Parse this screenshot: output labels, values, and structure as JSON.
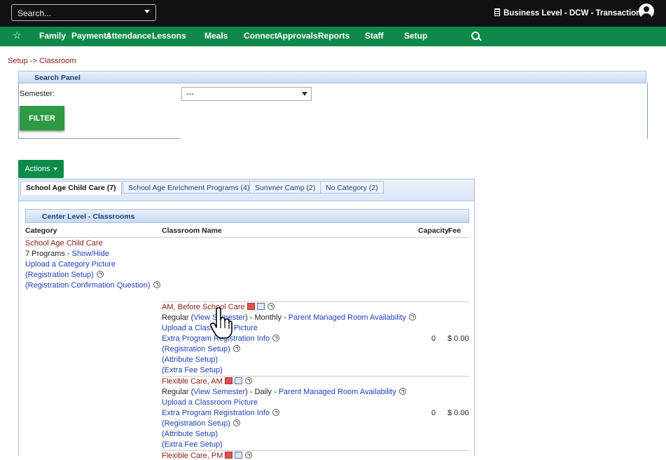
{
  "topbar": {
    "search_placeholder": "Search...",
    "business_level": "Business Level - DCW - Transactional"
  },
  "nav": {
    "items": [
      "Family",
      "Payments",
      "Attendance",
      "Lessons",
      "Meals",
      "Connect",
      "Approvals",
      "Reports",
      "Staff",
      "Setup"
    ]
  },
  "breadcrumb": "Setup -> Classroom",
  "search_panel": {
    "title": "Search Panel",
    "semester_label": "Semester:",
    "semester_value": "---",
    "filter_label": "FILTER"
  },
  "actions_label": "Actions",
  "tabs": [
    {
      "label": "School Age Child Care (7)",
      "active": true
    },
    {
      "label": "School Age Enrichment Programs (4)",
      "active": false
    },
    {
      "label": "Summer Camp (2)",
      "active": false
    },
    {
      "label": "No Category (2)",
      "active": false
    }
  ],
  "classrooms_panel": {
    "title": "Center Level - Classrooms",
    "columns": {
      "category": "Category",
      "name": "Classroom Name",
      "capacity": "Capacity",
      "fee": "Fee"
    }
  },
  "category": {
    "name": "School Age Child Care",
    "programs_count": "7 Programs",
    "dash": "-",
    "show_hide": "Show/Hide",
    "upload_picture": "Upload a Category Picture",
    "registration_setup": "(Registration Setup)",
    "confirmation_question": "(Registration Confirmation Question)"
  },
  "rows": [
    {
      "name": "AM, Before School Care",
      "type_prefix": "Regular (",
      "view_semester": "View Semester",
      "billing": ") - Monthly -",
      "parent_managed": "Parent Managed Room Availability",
      "upload_picture": "Upload a Classroom Picture",
      "extra_info": "Extra Program Registration Info",
      "registration_setup": "(Registration Setup)",
      "attribute_setup": "(Attribute Setup)",
      "extra_fee_setup": "(Extra Fee Setup)",
      "capacity": "0",
      "fee": "$ 0.00"
    },
    {
      "name": "Flexible Care, AM",
      "type_prefix": "Regular (",
      "view_semester": "View Semester",
      "billing": ") - Daily -",
      "parent_managed": "Parent Managed Room Availability",
      "upload_picture": "Upload a Classroom Picture",
      "extra_info": "Extra Program Registration Info",
      "registration_setup": "(Registration Setup)",
      "attribute_setup": "(Attribute Setup)",
      "extra_fee_setup": "(Extra Fee Setup)",
      "capacity": "0",
      "fee": "$ 0.00"
    },
    {
      "name": "Flexible Care, PM"
    }
  ]
}
